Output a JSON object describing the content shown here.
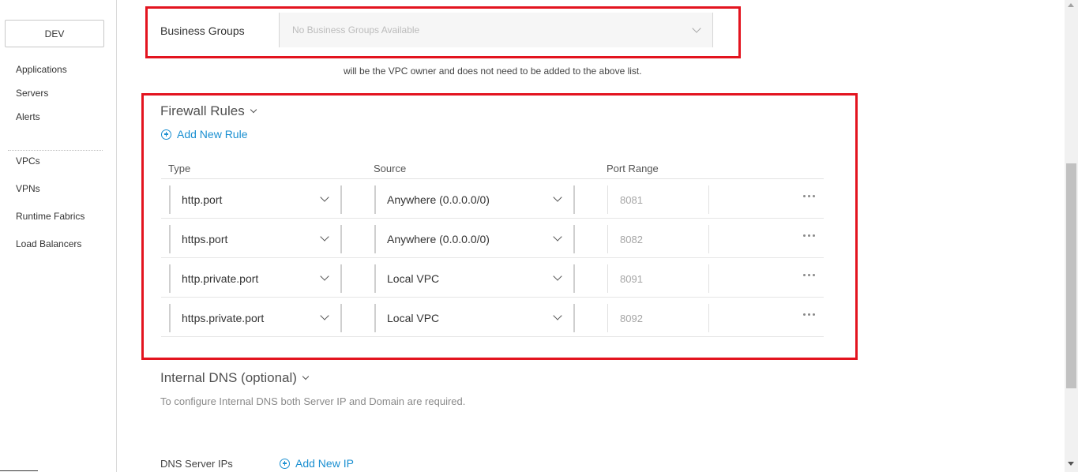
{
  "sidebar": {
    "env_button": "DEV",
    "items": [
      {
        "label": "Applications"
      },
      {
        "label": "Servers"
      },
      {
        "label": "Alerts"
      },
      {
        "label": "VPCs"
      },
      {
        "label": "VPNs"
      },
      {
        "label": "Runtime Fabrics"
      },
      {
        "label": "Load Balancers"
      }
    ]
  },
  "business_groups": {
    "label": "Business Groups",
    "placeholder": "No Business Groups Available"
  },
  "owner_note": "will be the VPC owner and does not need to be added to the above list.",
  "firewall": {
    "title": "Firewall Rules",
    "add_rule": "Add New Rule",
    "columns": {
      "type": "Type",
      "source": "Source",
      "port_range": "Port Range"
    },
    "rules": [
      {
        "type": "http.port",
        "source": "Anywhere (0.0.0.0/0)",
        "port": "8081"
      },
      {
        "type": "https.port",
        "source": "Anywhere (0.0.0.0/0)",
        "port": "8082"
      },
      {
        "type": "http.private.port",
        "source": "Local VPC",
        "port": "8091"
      },
      {
        "type": "https.private.port",
        "source": "Local VPC",
        "port": "8092"
      }
    ]
  },
  "dns": {
    "title": "Internal DNS (optional)",
    "description": "To configure Internal DNS both Server IP and Domain are required.",
    "server_ips_label": "DNS Server IPs",
    "add_ip": "Add New IP"
  },
  "colors": {
    "highlight_border": "#e3141f",
    "link": "#1a8fd1"
  }
}
